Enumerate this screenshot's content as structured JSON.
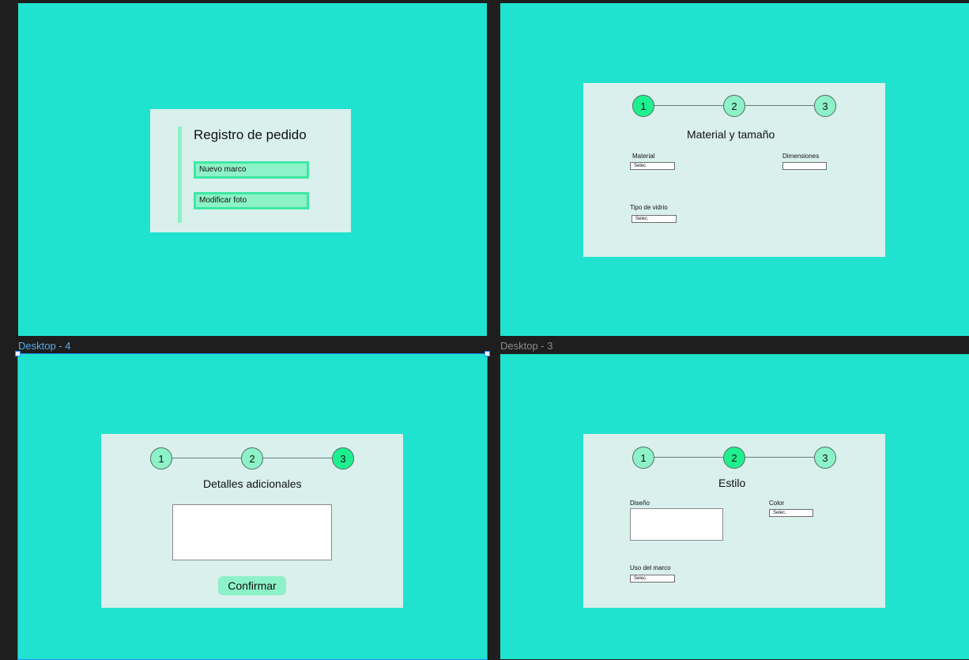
{
  "frames": {
    "top_left": {
      "card": {
        "title": "Registro de pedido",
        "buttons": [
          "Nuevo marco",
          "Modificar foto"
        ]
      }
    },
    "top_right": {
      "steps": [
        "1",
        "2",
        "3"
      ],
      "active_step": 1,
      "title": "Material y tamaño",
      "fields": {
        "material_label": "Material",
        "material_value": "Selec.",
        "dimensiones_label": "Dimensiones",
        "dimensiones_value": "",
        "vidrio_label": "Tipo de vidrio",
        "vidrio_value": "Selec."
      }
    },
    "bottom_left": {
      "name": "Desktop - 4",
      "selected": true,
      "steps": [
        "1",
        "2",
        "3"
      ],
      "active_step": 3,
      "title": "Detalles adicionales",
      "textarea_value": "",
      "confirm_label": "Confirmar"
    },
    "bottom_right": {
      "name": "Desktop - 3",
      "steps": [
        "1",
        "2",
        "3"
      ],
      "active_step": 2,
      "title": "Estilo",
      "fields": {
        "diseno_label": "Diseño",
        "color_label": "Color",
        "color_value": "Selec.",
        "uso_label": "Uso del marco",
        "uso_value": "Selec."
      }
    }
  },
  "colors": {
    "canvas": "#1e1e1e",
    "frame": "#1fe3cf",
    "card": "#d9f0ed",
    "step": "#8df2c7",
    "step_active": "#1ff08f",
    "selection": "#1c8cf5"
  }
}
